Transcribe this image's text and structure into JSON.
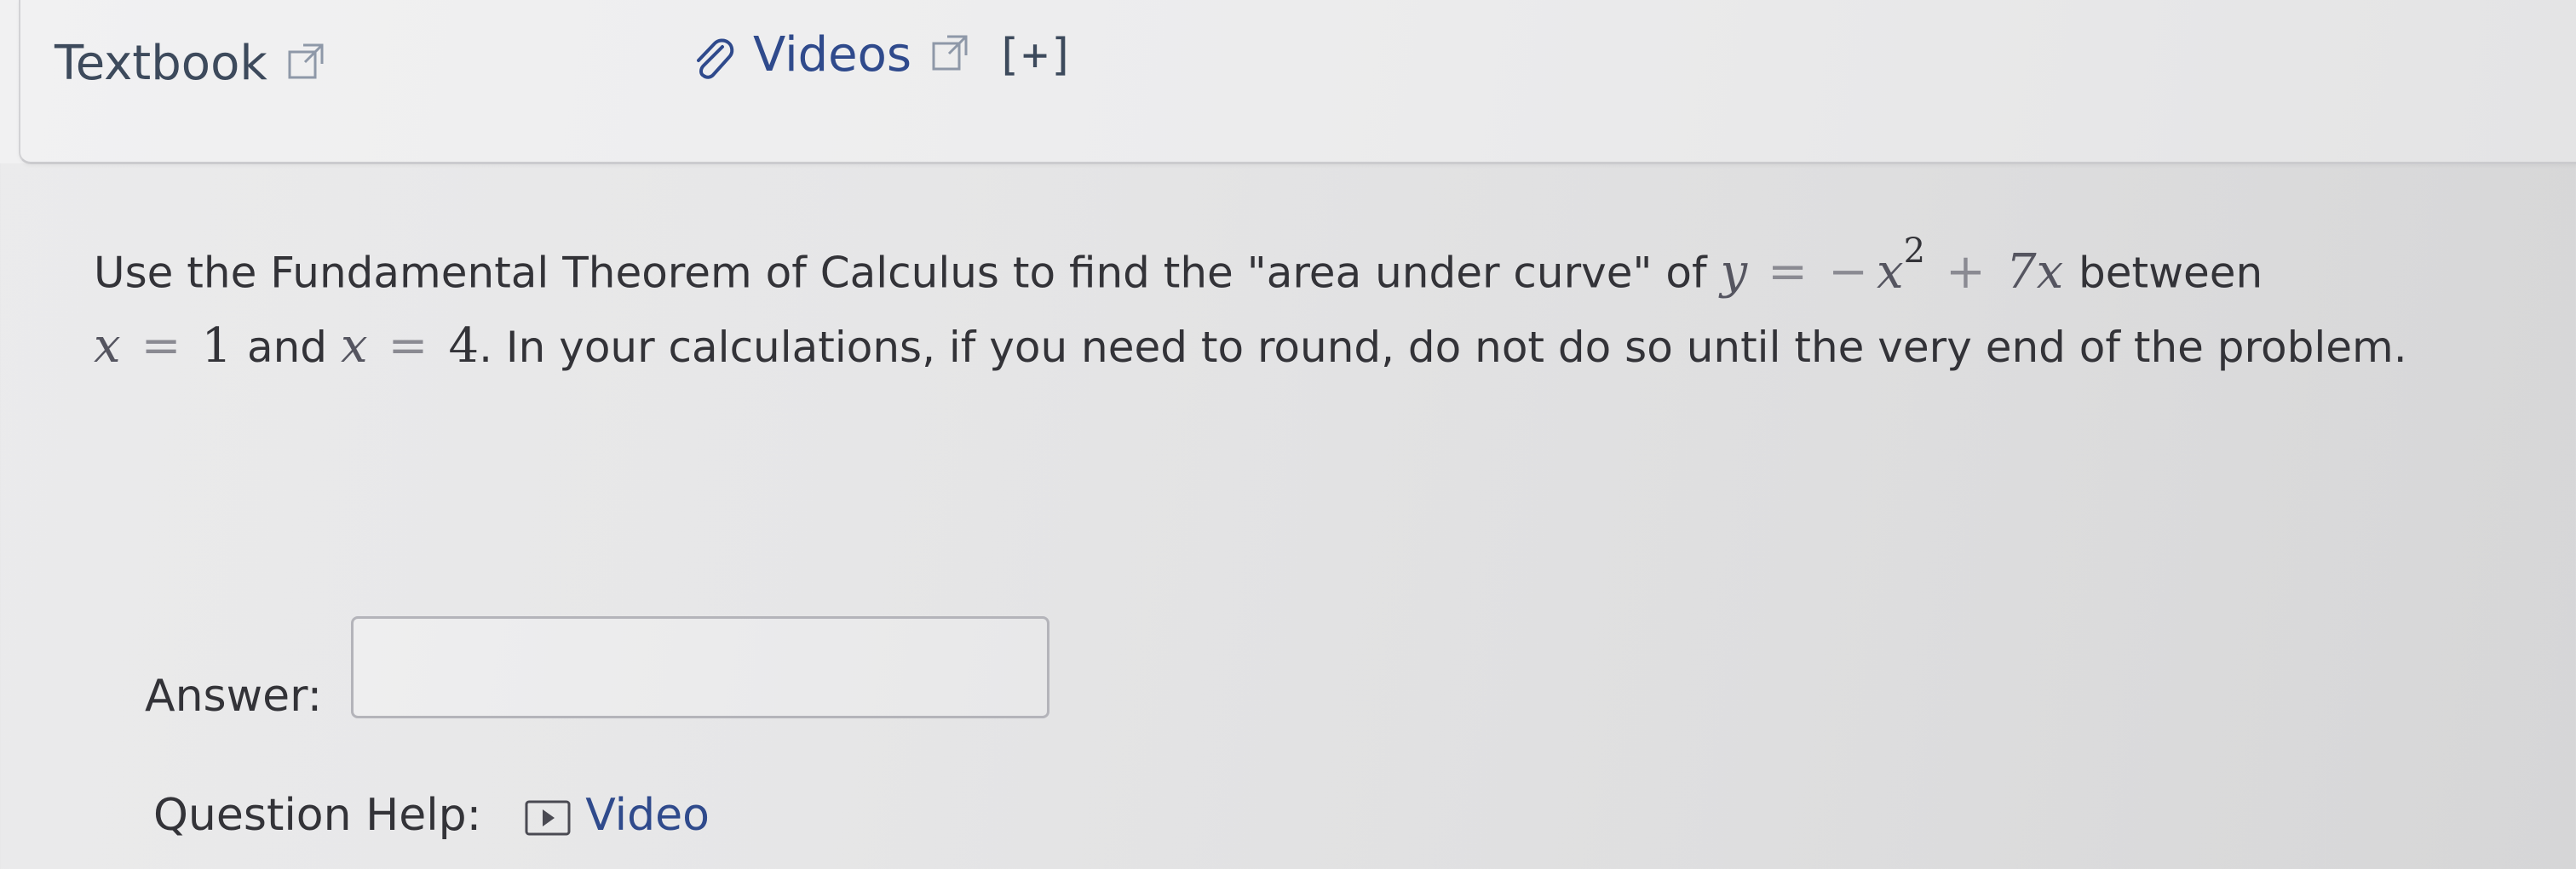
{
  "resources": {
    "textbook_label": "Textbook",
    "videos_label": "Videos",
    "expand_label": "[+]"
  },
  "question": {
    "text_before": "Use the Fundamental Theorem of Calculus to find the \"area under curve\" of",
    "equation": {
      "lhs": "y",
      "eq": "=",
      "minus": "−",
      "var": "x",
      "power": "2",
      "plus": "+",
      "term": "7x"
    },
    "text_between": "between",
    "bound1_var": "x",
    "bound1_eq": "=",
    "bound1_val": "1",
    "text_and": "and",
    "bound2_var": "x",
    "bound2_eq": "=",
    "bound2_val": "4",
    "text_after": ". In your calculations, if you need to round, do not do so until the very end of the problem."
  },
  "answer": {
    "label": "Answer:",
    "value": ""
  },
  "help": {
    "label": "Question Help:",
    "video_label": "Video"
  },
  "colors": {
    "link_blue": "#2f4a8c",
    "text": "#333338",
    "background": "#e6e6e7"
  },
  "icons": {
    "textbook": "external-link-icon",
    "videos": "paperclip-icon",
    "help_video": "play-icon"
  }
}
